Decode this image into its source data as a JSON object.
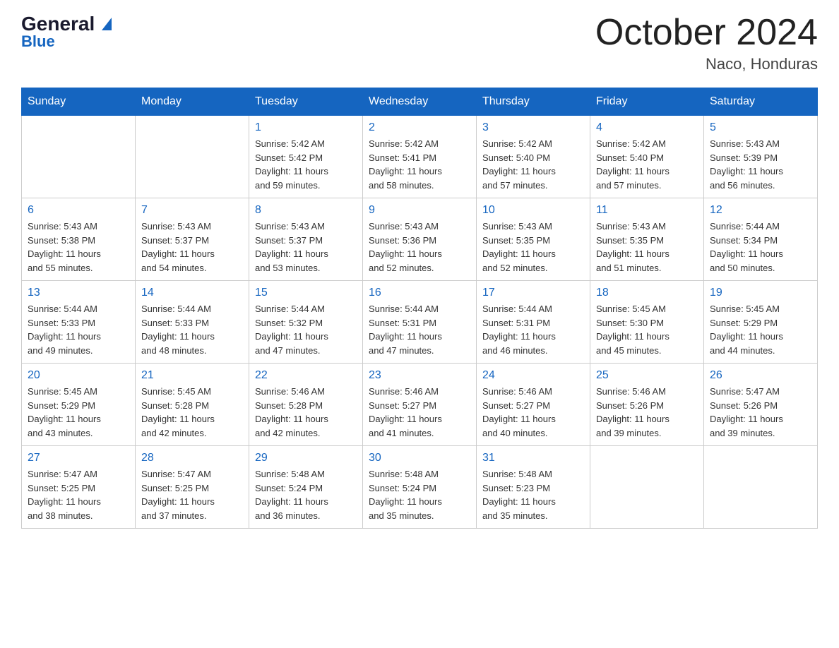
{
  "header": {
    "logo_line1": "General",
    "logo_line2": "Blue",
    "month_title": "October 2024",
    "location": "Naco, Honduras"
  },
  "days_of_week": [
    "Sunday",
    "Monday",
    "Tuesday",
    "Wednesday",
    "Thursday",
    "Friday",
    "Saturday"
  ],
  "weeks": [
    [
      {
        "day": "",
        "info": ""
      },
      {
        "day": "",
        "info": ""
      },
      {
        "day": "1",
        "info": "Sunrise: 5:42 AM\nSunset: 5:42 PM\nDaylight: 11 hours\nand 59 minutes."
      },
      {
        "day": "2",
        "info": "Sunrise: 5:42 AM\nSunset: 5:41 PM\nDaylight: 11 hours\nand 58 minutes."
      },
      {
        "day": "3",
        "info": "Sunrise: 5:42 AM\nSunset: 5:40 PM\nDaylight: 11 hours\nand 57 minutes."
      },
      {
        "day": "4",
        "info": "Sunrise: 5:42 AM\nSunset: 5:40 PM\nDaylight: 11 hours\nand 57 minutes."
      },
      {
        "day": "5",
        "info": "Sunrise: 5:43 AM\nSunset: 5:39 PM\nDaylight: 11 hours\nand 56 minutes."
      }
    ],
    [
      {
        "day": "6",
        "info": "Sunrise: 5:43 AM\nSunset: 5:38 PM\nDaylight: 11 hours\nand 55 minutes."
      },
      {
        "day": "7",
        "info": "Sunrise: 5:43 AM\nSunset: 5:37 PM\nDaylight: 11 hours\nand 54 minutes."
      },
      {
        "day": "8",
        "info": "Sunrise: 5:43 AM\nSunset: 5:37 PM\nDaylight: 11 hours\nand 53 minutes."
      },
      {
        "day": "9",
        "info": "Sunrise: 5:43 AM\nSunset: 5:36 PM\nDaylight: 11 hours\nand 52 minutes."
      },
      {
        "day": "10",
        "info": "Sunrise: 5:43 AM\nSunset: 5:35 PM\nDaylight: 11 hours\nand 52 minutes."
      },
      {
        "day": "11",
        "info": "Sunrise: 5:43 AM\nSunset: 5:35 PM\nDaylight: 11 hours\nand 51 minutes."
      },
      {
        "day": "12",
        "info": "Sunrise: 5:44 AM\nSunset: 5:34 PM\nDaylight: 11 hours\nand 50 minutes."
      }
    ],
    [
      {
        "day": "13",
        "info": "Sunrise: 5:44 AM\nSunset: 5:33 PM\nDaylight: 11 hours\nand 49 minutes."
      },
      {
        "day": "14",
        "info": "Sunrise: 5:44 AM\nSunset: 5:33 PM\nDaylight: 11 hours\nand 48 minutes."
      },
      {
        "day": "15",
        "info": "Sunrise: 5:44 AM\nSunset: 5:32 PM\nDaylight: 11 hours\nand 47 minutes."
      },
      {
        "day": "16",
        "info": "Sunrise: 5:44 AM\nSunset: 5:31 PM\nDaylight: 11 hours\nand 47 minutes."
      },
      {
        "day": "17",
        "info": "Sunrise: 5:44 AM\nSunset: 5:31 PM\nDaylight: 11 hours\nand 46 minutes."
      },
      {
        "day": "18",
        "info": "Sunrise: 5:45 AM\nSunset: 5:30 PM\nDaylight: 11 hours\nand 45 minutes."
      },
      {
        "day": "19",
        "info": "Sunrise: 5:45 AM\nSunset: 5:29 PM\nDaylight: 11 hours\nand 44 minutes."
      }
    ],
    [
      {
        "day": "20",
        "info": "Sunrise: 5:45 AM\nSunset: 5:29 PM\nDaylight: 11 hours\nand 43 minutes."
      },
      {
        "day": "21",
        "info": "Sunrise: 5:45 AM\nSunset: 5:28 PM\nDaylight: 11 hours\nand 42 minutes."
      },
      {
        "day": "22",
        "info": "Sunrise: 5:46 AM\nSunset: 5:28 PM\nDaylight: 11 hours\nand 42 minutes."
      },
      {
        "day": "23",
        "info": "Sunrise: 5:46 AM\nSunset: 5:27 PM\nDaylight: 11 hours\nand 41 minutes."
      },
      {
        "day": "24",
        "info": "Sunrise: 5:46 AM\nSunset: 5:27 PM\nDaylight: 11 hours\nand 40 minutes."
      },
      {
        "day": "25",
        "info": "Sunrise: 5:46 AM\nSunset: 5:26 PM\nDaylight: 11 hours\nand 39 minutes."
      },
      {
        "day": "26",
        "info": "Sunrise: 5:47 AM\nSunset: 5:26 PM\nDaylight: 11 hours\nand 39 minutes."
      }
    ],
    [
      {
        "day": "27",
        "info": "Sunrise: 5:47 AM\nSunset: 5:25 PM\nDaylight: 11 hours\nand 38 minutes."
      },
      {
        "day": "28",
        "info": "Sunrise: 5:47 AM\nSunset: 5:25 PM\nDaylight: 11 hours\nand 37 minutes."
      },
      {
        "day": "29",
        "info": "Sunrise: 5:48 AM\nSunset: 5:24 PM\nDaylight: 11 hours\nand 36 minutes."
      },
      {
        "day": "30",
        "info": "Sunrise: 5:48 AM\nSunset: 5:24 PM\nDaylight: 11 hours\nand 35 minutes."
      },
      {
        "day": "31",
        "info": "Sunrise: 5:48 AM\nSunset: 5:23 PM\nDaylight: 11 hours\nand 35 minutes."
      },
      {
        "day": "",
        "info": ""
      },
      {
        "day": "",
        "info": ""
      }
    ]
  ]
}
